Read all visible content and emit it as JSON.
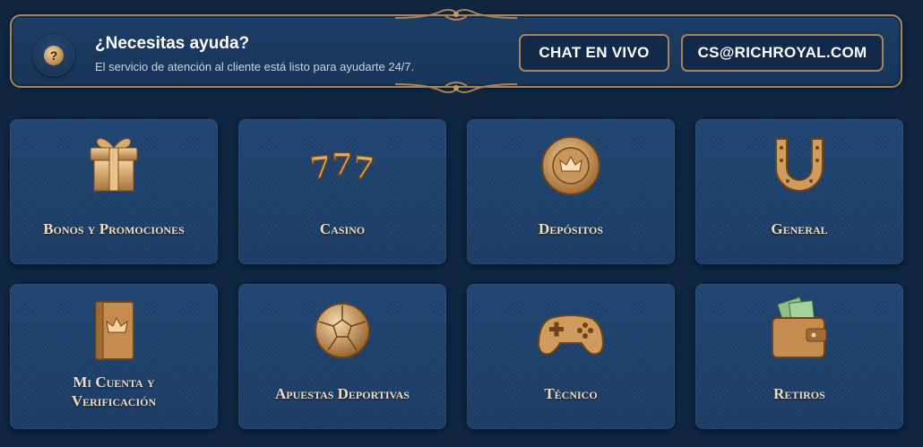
{
  "help": {
    "icon": "question-icon",
    "icon_glyph": "?",
    "title": "¿Necesitas ayuda?",
    "subtitle": "El servicio de atención al cliente está listo para ayudarte 24/7.",
    "chat_label": "CHAT EN VIVO",
    "email_label": "CS@RICHROYAL.COM"
  },
  "categories": [
    {
      "label": "Bonos y Promociones",
      "icon": "gift-icon"
    },
    {
      "label": "Casino",
      "icon": "slot-777-icon"
    },
    {
      "label": "Depósitos",
      "icon": "chip-icon"
    },
    {
      "label": "General",
      "icon": "horseshoe-icon"
    },
    {
      "label_line1": "Mi Cuenta y",
      "label_line2": "Verificación",
      "icon": "book-icon"
    },
    {
      "label": "Apuestas Deportivas",
      "icon": "football-icon"
    },
    {
      "label": "Técnico",
      "icon": "gamepad-icon"
    },
    {
      "label": "Retiros",
      "icon": "wallet-icon"
    }
  ],
  "colors": {
    "background": "#0f2540",
    "gold_border": "#a78457",
    "tile_label": "#f0dcc0"
  }
}
